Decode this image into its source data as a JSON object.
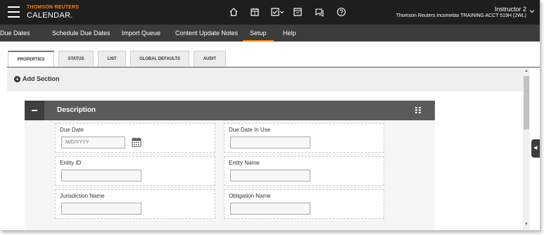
{
  "brand": {
    "line1": "THOMSON REUTERS",
    "line2": "CALENDAR."
  },
  "topbar_icons": [
    "home-icon",
    "calendar-icon",
    "checklist-icon",
    "tray-icon",
    "chat-icon",
    "help-icon"
  ],
  "user": {
    "name": "Instructor 2",
    "account": "Thomson Reuters Incometax TRAINING ACCT 519H (2WL)"
  },
  "nav": {
    "items": [
      {
        "label": "Due Dates"
      },
      {
        "label": "Schedule Due Dates"
      },
      {
        "label": "Import Queue"
      },
      {
        "label": "Content Update Notes"
      },
      {
        "label": "Setup"
      },
      {
        "label": "Help"
      }
    ],
    "active": "Setup"
  },
  "tabs": {
    "items": [
      {
        "label": "PROPERTIES"
      },
      {
        "label": "STATUS"
      },
      {
        "label": "LIST"
      },
      {
        "label": "GLOBAL DEFAULTS"
      },
      {
        "label": "AUDIT"
      }
    ],
    "active": "PROPERTIES"
  },
  "add_section": {
    "label": "Add Section"
  },
  "section": {
    "title": "Description",
    "fields": [
      {
        "label": "Due Date",
        "placeholder": "M/D/YYYY"
      },
      {
        "label": "Due Date In Use"
      },
      {
        "label": "Entity ID"
      },
      {
        "label": "Entity Name"
      },
      {
        "label": "Jurisdiction Name"
      },
      {
        "label": "Obligation Name"
      }
    ]
  },
  "colors": {
    "accent": "#ff8000",
    "topbar": "#1e1e1e",
    "nav": "#3c3c3c",
    "section_header": "#5a5a5a"
  }
}
